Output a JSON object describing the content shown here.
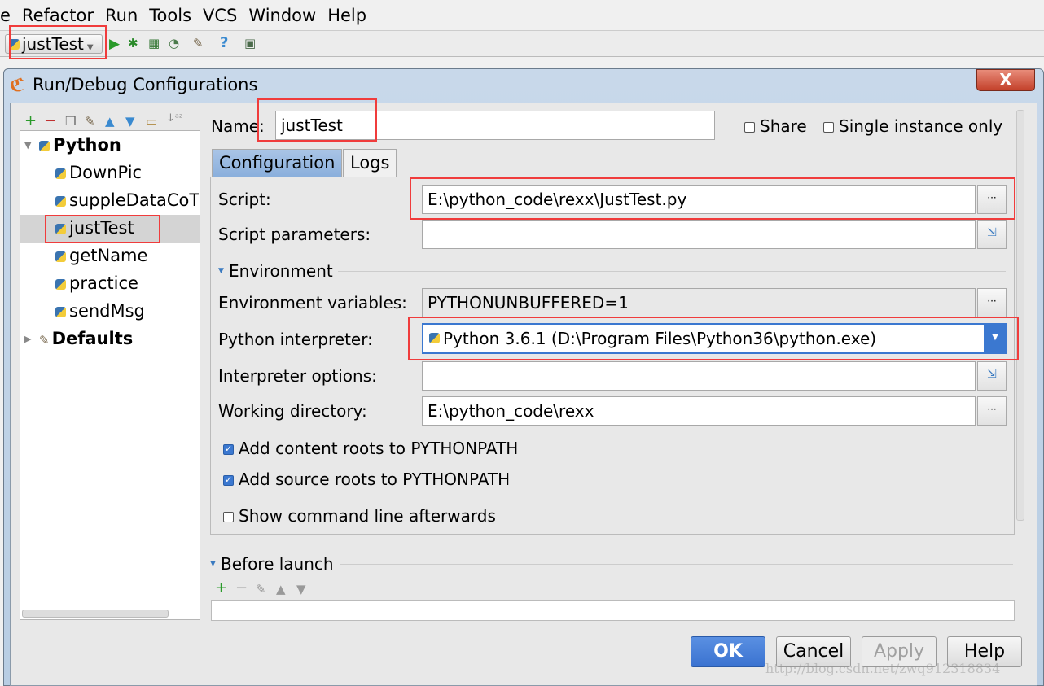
{
  "menubar": {
    "items": [
      "e",
      "Refactor",
      "Run",
      "Tools",
      "VCS",
      "Window",
      "Help"
    ]
  },
  "toolbar": {
    "run_config": "justTest",
    "icons": [
      "run-icon",
      "debug-icon",
      "coverage-icon",
      "profile-icon",
      "settings-icon",
      "help-icon",
      "sdk-icon"
    ]
  },
  "dialog": {
    "title": "Run/Debug Configurations",
    "close_label": "X",
    "tree_toolbar": [
      "add-icon",
      "remove-icon",
      "copy-icon",
      "edit-defaults-icon",
      "move-up-icon",
      "move-down-icon",
      "folder-icon",
      "sort-icon"
    ],
    "tree": {
      "python": "Python",
      "children": [
        "DownPic",
        "suppleDataCoT",
        "justTest",
        "getName",
        "practice",
        "sendMsg"
      ],
      "selected": "justTest",
      "defaults": "Defaults"
    },
    "name_label": "Name:",
    "name_value": "justTest",
    "share_label": "Share",
    "single_instance_label": "Single instance only",
    "tabs": [
      "Configuration",
      "Logs"
    ],
    "active_tab": "Configuration",
    "script_label": "Script:",
    "script_value": "E:\\python_code\\rexx\\JustTest.py",
    "script_params_label": "Script parameters:",
    "script_params_value": "",
    "environment_label": "Environment",
    "env_vars_label": "Environment variables:",
    "env_vars_value": "PYTHONUNBUFFERED=1",
    "interpreter_label": "Python interpreter:",
    "interpreter_value": "Python 3.6.1 (D:\\Program Files\\Python36\\python.exe)",
    "interp_options_label": "Interpreter options:",
    "interp_options_value": "",
    "workdir_label": "Working directory:",
    "workdir_value": "E:\\python_code\\rexx",
    "add_content_roots": {
      "label": "Add content roots to PYTHONPATH",
      "checked": true
    },
    "add_source_roots": {
      "label": "Add source roots to PYTHONPATH",
      "checked": true
    },
    "show_cmdline": {
      "label": "Show command line afterwards",
      "checked": false
    },
    "before_launch_label": "Before launch",
    "buttons": {
      "ok": "OK",
      "cancel": "Cancel",
      "apply": "Apply",
      "help": "Help"
    }
  },
  "watermark": "http://blog.csdn.net/zwq912318834",
  "colors": {
    "highlight": "#f03c3c",
    "ok_button": "#4a80d8",
    "selection": "#d4d4d4"
  }
}
